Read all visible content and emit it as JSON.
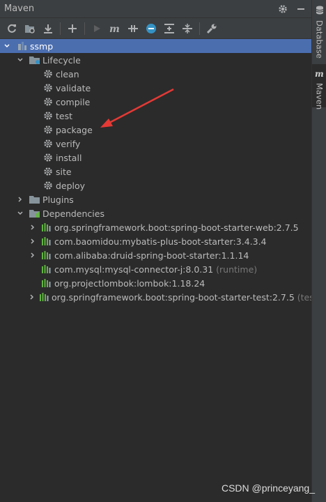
{
  "window": {
    "title": "Maven"
  },
  "toolbar": {
    "buttons": [
      "reload-icon",
      "generate-sources-icon",
      "download-icon",
      "add-icon",
      "run-icon",
      "maven-goal-icon",
      "toggle-offline-icon",
      "skip-tests-icon",
      "show-dependencies-icon",
      "collapse-all-icon",
      "settings-wrench-icon"
    ]
  },
  "tree": {
    "project": "ssmp",
    "lifecycle": {
      "label": "Lifecycle",
      "items": [
        "clean",
        "validate",
        "compile",
        "test",
        "package",
        "verify",
        "install",
        "site",
        "deploy"
      ]
    },
    "plugins": {
      "label": "Plugins"
    },
    "dependencies": {
      "label": "Dependencies",
      "items": [
        {
          "name": "org.springframework.boot:spring-boot-starter-web:2.7.5",
          "scope": ""
        },
        {
          "name": "com.baomidou:mybatis-plus-boot-starter:3.4.3.4",
          "scope": ""
        },
        {
          "name": "com.alibaba:druid-spring-boot-starter:1.1.14",
          "scope": ""
        },
        {
          "name": "com.mysql:mysql-connector-j:8.0.31",
          "scope": "(runtime)"
        },
        {
          "name": "org.projectlombok:lombok:1.18.24",
          "scope": ""
        },
        {
          "name": "org.springframework.boot:spring-boot-starter-test:2.7.5",
          "scope": "(test)"
        }
      ]
    }
  },
  "sidebar": {
    "tabs": [
      "Database",
      "Maven"
    ]
  },
  "watermark": "CSDN @princeyang_",
  "colors": {
    "selection": "#4b6eaf",
    "annotation_arrow": "#e53935",
    "gear": "#afb1b3",
    "folder": "#87939a",
    "dependency_bars": "#62b543"
  }
}
